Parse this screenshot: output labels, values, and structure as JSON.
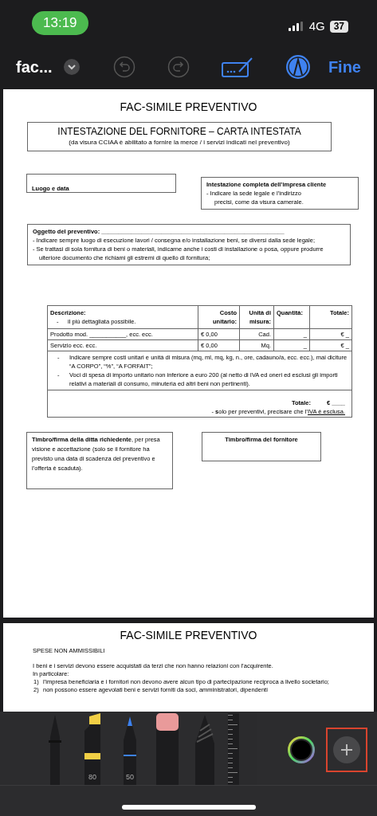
{
  "status_bar": {
    "time": "13:19",
    "network": "4G",
    "battery": "37"
  },
  "toolbar": {
    "title": "fac...",
    "done": "Fine"
  },
  "page_1": {
    "title": "FAC-SIMILE PREVENTIVO",
    "supplier_header": {
      "title": "INTESTAZIONE DEL FORNITORE – CARTA INTESTATA",
      "subtitle": "(da visura CCIAA è abilitato a fornire la merce / i servizi indicati nel preventivo)"
    },
    "place_date": "Luogo e data",
    "client_header": {
      "title": "Intestazione completa dell’impresa cliente",
      "lines": [
        "- Indicare la sede legale e l’indirizzo",
        "precisi, come da visura camerale."
      ]
    },
    "subject": {
      "title": "Oggetto del preventivo: _______________________________________________________",
      "lines": [
        "- Indicare sempre luogo di esecuzione lavori / consegna e/o installazione beni, se diversi dalla sede legale;",
        "- Se trattasi di sola fornitura di beni o materiali, indicarne anche i costi di installazione o posa, oppure produrre ulteriore documento che richiami gli estremi di quello di fornitura;"
      ]
    },
    "table": {
      "columns": [
        {
          "label": "Descrizione:",
          "note_bullet": "-",
          "note": "il più dettagliata possibile."
        },
        {
          "label": "Costo unitario:"
        },
        {
          "label": "Unità di misura:"
        },
        {
          "label": "Quantità:"
        },
        {
          "label": "Totale:"
        }
      ],
      "rows": [
        [
          "Prodotto mod. ___________, ecc. ecc.",
          "€ 0,00",
          "Cad.",
          "_",
          "€ _"
        ],
        [
          "Servizio ecc. ecc.",
          "€ 0,00",
          "Mq.",
          "_",
          "€ _"
        ]
      ],
      "notes": [
        {
          "bullet": "-",
          "text": "Indicare sempre costi unitari e unità di misura (mq, ml, mq, kg, n., ore, cadauno/a, ecc. ecc.), mai diciture “A CORPO”, “%”, “A FORFAIT”;"
        },
        {
          "bullet": "-",
          "text": "Voci di spesa di importo unitario non inferiore a euro 200 (al netto di IVA ed oneri ed esclusi gli importi relativi a materiali di consumo, minuteria ed altri beni non pertinenti)."
        }
      ],
      "total_label": "Totale:",
      "total_value": "€ ____",
      "total_note": "- **s**olo per preventivi, precisare che l’",
      "total_note_underlined": "IVA è esclusa."
    },
    "client_signature": "**Timbro/firma della ditta richiedente**, per presa visione e accettazione (solo se il fornitore ha previsto una data di scadenza del preventivo e l’offerta è scaduta).",
    "supplier_signature": "Timbro/firma del fornitore"
  },
  "page_2": {
    "title": "FAC-SIMILE PREVENTIVO",
    "heading": "SPESE NON AMMISSIBILI",
    "paragraphs": [
      "I beni e i servizi devono essere acquistati da terzi che non hanno relazioni con l’acquirente.",
      "In particolare:"
    ],
    "items": [
      {
        "number": "1)",
        "text": "l’impresa beneficiaria e i fornitori non devono avere alcun tipo di partecipazione reciproca a livello societario;"
      },
      {
        "number": "2)",
        "text": "non possono essere agevolati beni e servizi forniti da soci, amministratori, dipendenti"
      }
    ]
  },
  "tools": [
    {
      "kind": "pen"
    },
    {
      "kind": "highlighter",
      "label": "80"
    },
    {
      "kind": "marker",
      "label": "50"
    },
    {
      "kind": "eraser"
    },
    {
      "kind": "pencil"
    },
    {
      "kind": "ruler"
    }
  ],
  "add_button": {
    "highlighted": true
  }
}
